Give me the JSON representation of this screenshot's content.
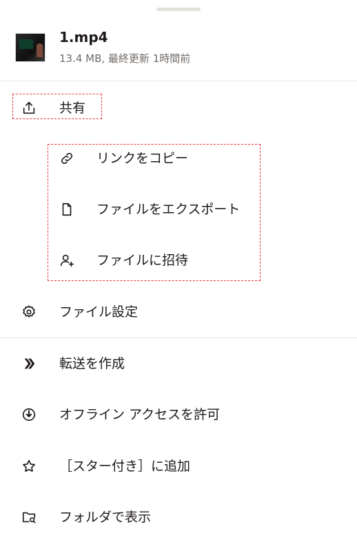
{
  "file": {
    "name": "1.mp4",
    "meta": "13.4 MB, 最終更新 1時間前"
  },
  "menu": {
    "share": "共有",
    "copy_link": "リンクをコピー",
    "export_file": "ファイルをエクスポート",
    "invite_to_file": "ファイルに招待",
    "file_settings": "ファイル設定",
    "create_transfer": "転送を作成",
    "allow_offline": "オフライン アクセスを許可",
    "add_starred": "［スター付き］に追加",
    "show_in_folder": "フォルダで表示"
  },
  "colors": {
    "highlight_dash": "#e8323c",
    "text": "#1e1919",
    "meta": "#6f6a66"
  }
}
